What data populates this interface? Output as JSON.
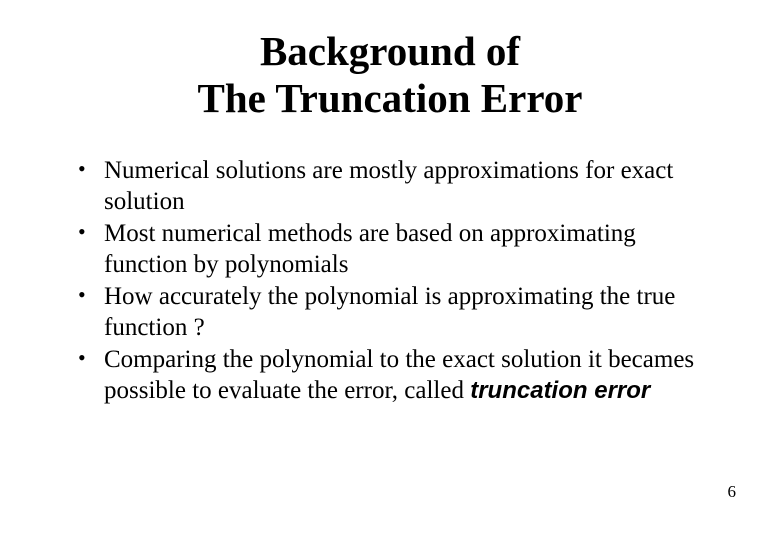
{
  "title_line1": "Background of",
  "title_line2": "The Truncation Error",
  "bullets": [
    {
      "text": "Numerical solutions are mostly approximations for exact solution"
    },
    {
      "text": "Most numerical methods are based on approximating function by polynomials"
    },
    {
      "text": "How accurately the polynomial is approximating the true function ?"
    },
    {
      "lead": "Comparing the polynomial to the exact solution it becames possible to evaluate the error, called ",
      "emph": "truncation error"
    }
  ],
  "page_number": "6"
}
